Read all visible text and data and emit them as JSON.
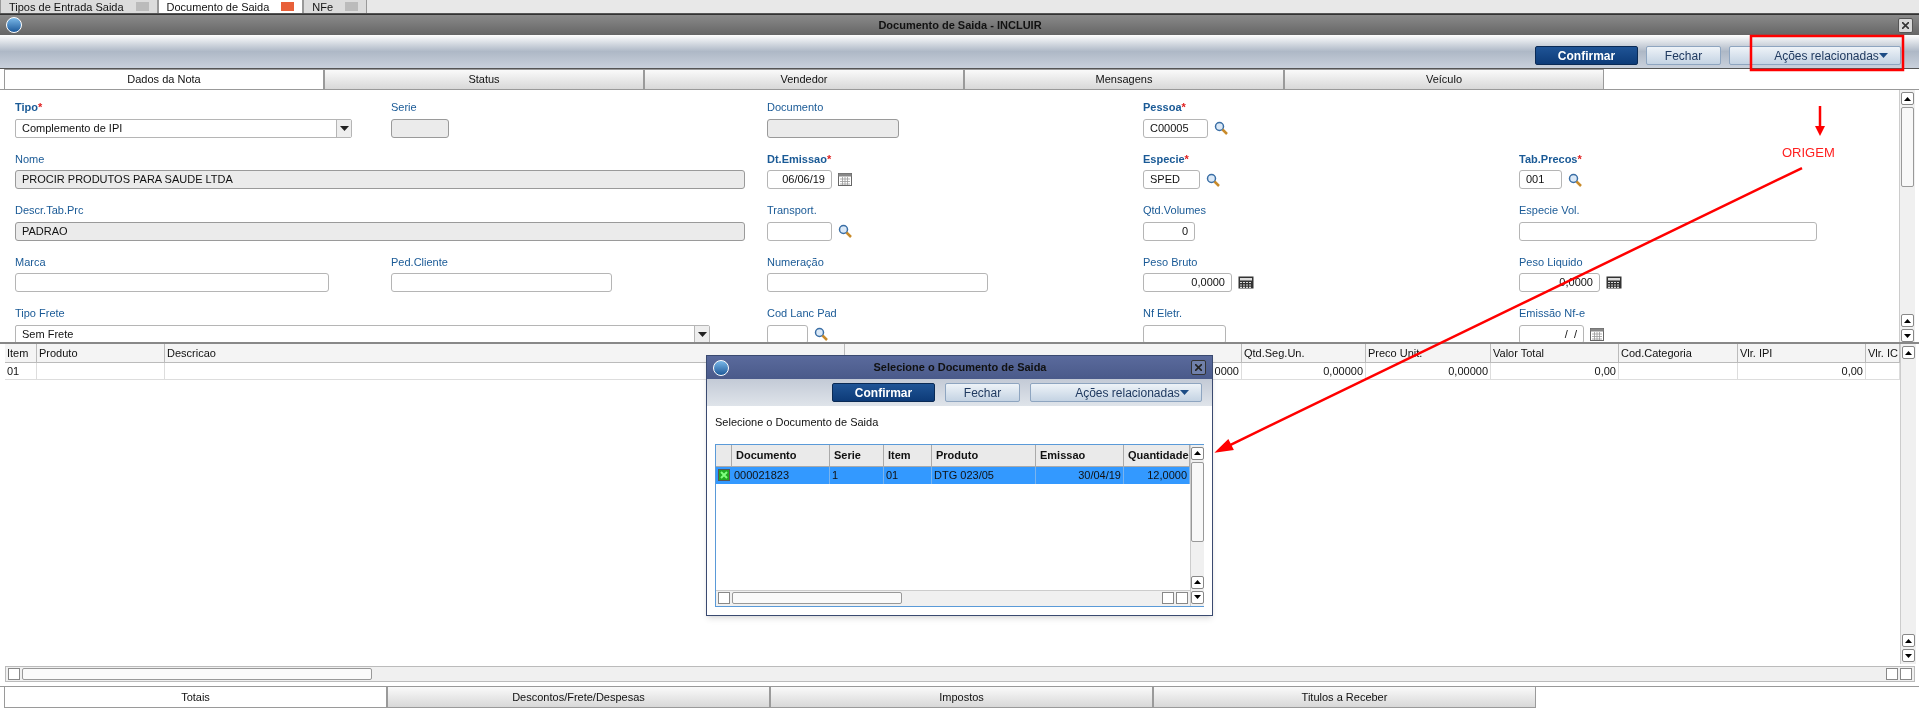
{
  "app_tabs": [
    {
      "label": "Tipos de Entrada Saida",
      "selected": false
    },
    {
      "label": "Documento de Saida",
      "selected": true
    },
    {
      "label": "NFe",
      "selected": false
    }
  ],
  "window": {
    "title": "Documento de Saida - INCLUIR"
  },
  "toolbar": {
    "buttons": [
      {
        "label": "Confirmar",
        "kind": "primary"
      },
      {
        "label": "Fechar",
        "kind": "secondary"
      },
      {
        "label": "Ações relacionadas",
        "kind": "menu"
      }
    ]
  },
  "tabs": [
    {
      "label": "Dados da Nota",
      "selected": true
    },
    {
      "label": "Status",
      "selected": false
    },
    {
      "label": "Vendedor",
      "selected": false
    },
    {
      "label": "Mensagens",
      "selected": false
    },
    {
      "label": "Veículo",
      "selected": false
    }
  ],
  "form": {
    "rows": [
      [
        {
          "label": "Tipo",
          "required": "*",
          "kind": "select",
          "value": "Complemento de IPI"
        },
        {
          "label": "Serie",
          "required": false,
          "kind": "readonly"
        },
        {
          "label": "Documento",
          "required": false,
          "kind": "readonly"
        },
        {
          "label": "Pessoa",
          "required": "*",
          "kind": "lookup",
          "value": "C00005"
        }
      ],
      [
        {
          "label": "Nome",
          "required": false,
          "kind": "readonly",
          "value": "PROCIR PRODUTOS PARA SAUDE LTDA"
        },
        {
          "label": "Dt.Emissao",
          "required": "*",
          "kind": "date",
          "value": "06/06/19"
        },
        {
          "label": "Especie",
          "required": "*",
          "kind": "lookup",
          "value": "SPED"
        },
        {
          "label": "Tab.Precos",
          "required": "*",
          "kind": "lookup",
          "value": "001"
        }
      ],
      [
        {
          "label": "Descr.Tab.Prc",
          "required": false,
          "kind": "readonly",
          "value": "PADRAO"
        },
        {
          "label": "Transport.",
          "required": false,
          "kind": "lookup"
        },
        {
          "label": "Qtd.Volumes",
          "required": false,
          "kind": "number",
          "value": "0"
        },
        {
          "label": "Especie Vol.",
          "required": false,
          "kind": "text"
        }
      ],
      [
        {
          "label": "Marca",
          "required": false,
          "kind": "text"
        },
        {
          "label": "Ped.Cliente",
          "required": false,
          "kind": "text"
        },
        {
          "label": "Numeração",
          "required": false,
          "kind": "text"
        },
        {
          "label": "Peso Bruto",
          "required": false,
          "kind": "calc",
          "value": "0,0000"
        },
        {
          "label": "Peso Liquido",
          "required": false,
          "kind": "calc",
          "value": "0,0000"
        }
      ],
      [
        {
          "label": "Tipo Frete",
          "required": false,
          "kind": "select",
          "value": "Sem Frete"
        },
        {
          "label": "Cod Lanc Pad",
          "required": false,
          "kind": "lookup"
        },
        {
          "label": "Nf Eletr.",
          "required": false,
          "kind": "text"
        },
        {
          "label": "Emissão Nf-e",
          "required": false,
          "kind": "date",
          "value": " /  /"
        }
      ]
    ]
  },
  "grid": {
    "columns": [
      "Item",
      "Produto",
      "Descricao",
      null,
      "Qtd.Seg.Un.",
      "Preco Unit.",
      "Valor Total",
      "Cod.Categoria",
      "Vlr. IPI",
      "Vlr. IC"
    ],
    "rows": [
      {
        "cells": [
          "01",
          null,
          null,
          "0000",
          "0,00000",
          "0,00000",
          "0,00",
          null,
          "0,00",
          null
        ]
      }
    ]
  },
  "bottom_tabs": [
    {
      "label": "Totais",
      "selected": true
    },
    {
      "label": "Descontos/Frete/Despesas",
      "selected": false
    },
    {
      "label": "Impostos",
      "selected": false
    },
    {
      "label": "Titulos a Receber",
      "selected": false
    }
  ],
  "annotation": {
    "label": "ORIGEM"
  },
  "dialog": {
    "title": "Selecione o Documento de Saida",
    "buttons": [
      {
        "label": "Confirmar",
        "kind": "primary"
      },
      {
        "label": "Fechar",
        "kind": "secondary"
      },
      {
        "label": "Ações relacionadas",
        "kind": "menu"
      }
    ],
    "prompt": "Selecione o Documento de Saida",
    "columns": [
      "Documento",
      "Serie",
      "Item",
      "Produto",
      "Emissao",
      "Quantidade"
    ],
    "rows": [
      {
        "checked": true,
        "selected": true,
        "cells": [
          "000021823",
          "1",
          "01",
          "DTG 023/05",
          "30/04/19",
          "12,0000"
        ]
      }
    ]
  }
}
